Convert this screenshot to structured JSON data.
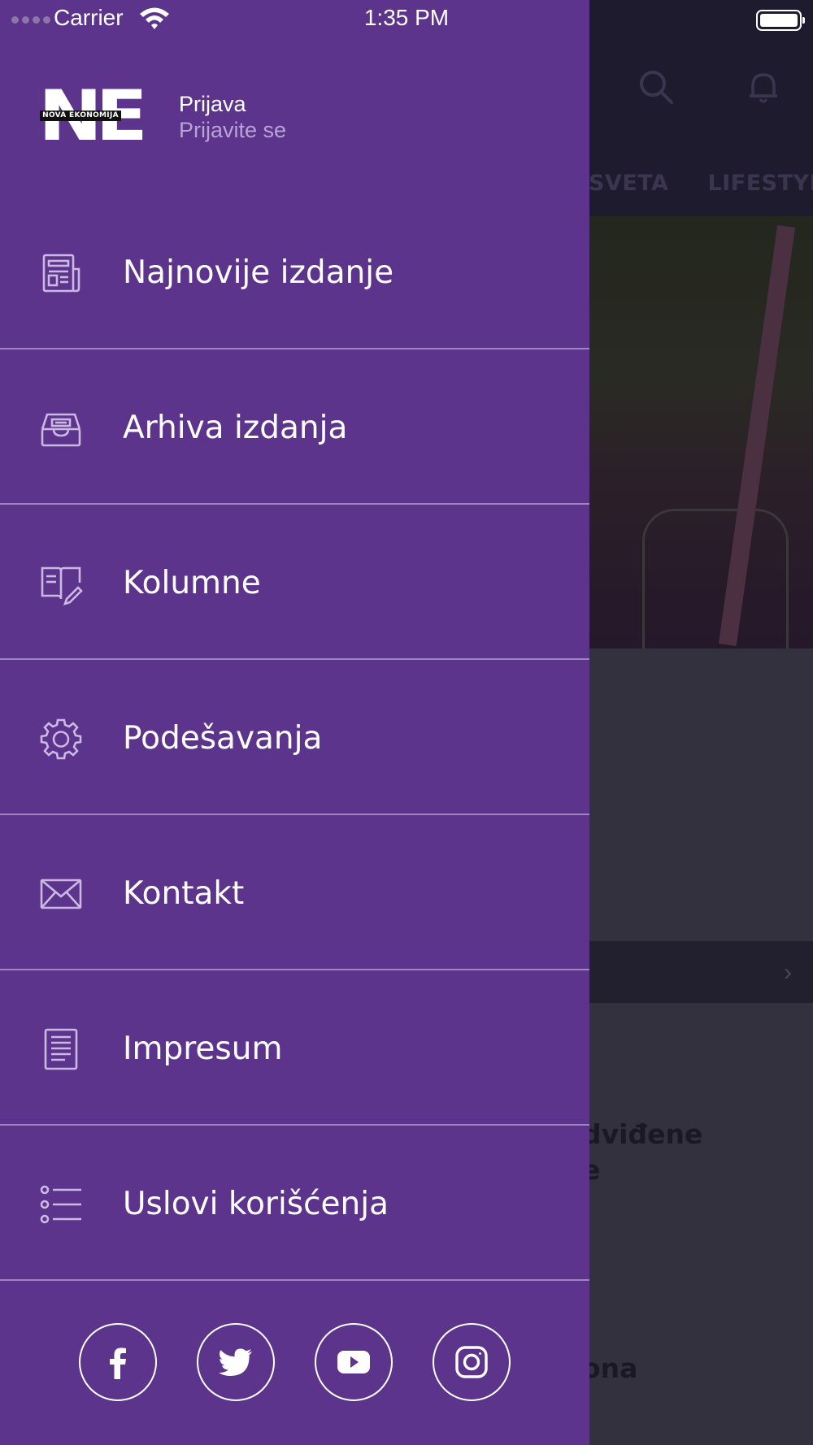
{
  "status_bar": {
    "carrier": "Carrier",
    "time": "1:35 PM"
  },
  "background": {
    "tabs": [
      "SVETA",
      "LIFESTYL"
    ],
    "headline_fragment": [
      "dviđene",
      "e"
    ],
    "bottom_fragment": "ona"
  },
  "drawer": {
    "logo": {
      "letters": "NE",
      "band_text": "NOVA EKONOMIJA"
    },
    "login": {
      "title": "Prijava",
      "subtitle": "Prijavite se"
    },
    "menu": [
      {
        "label": "Najnovije izdanje",
        "icon": "newspaper-icon"
      },
      {
        "label": "Arhiva izdanja",
        "icon": "archive-icon"
      },
      {
        "label": "Kolumne",
        "icon": "column-edit-icon"
      },
      {
        "label": "Podešavanja",
        "icon": "gear-icon"
      },
      {
        "label": "Kontakt",
        "icon": "envelope-icon"
      },
      {
        "label": "Impresum",
        "icon": "document-icon"
      },
      {
        "label": "Uslovi korišćenja",
        "icon": "list-icon"
      }
    ],
    "social": [
      "facebook-icon",
      "twitter-icon",
      "youtube-icon",
      "instagram-icon"
    ]
  },
  "colors": {
    "drawer": "#5c348c",
    "divider": "#9e86bf",
    "subtitle": "#b9a3d6",
    "overlay_header": "#1f1b2e"
  }
}
